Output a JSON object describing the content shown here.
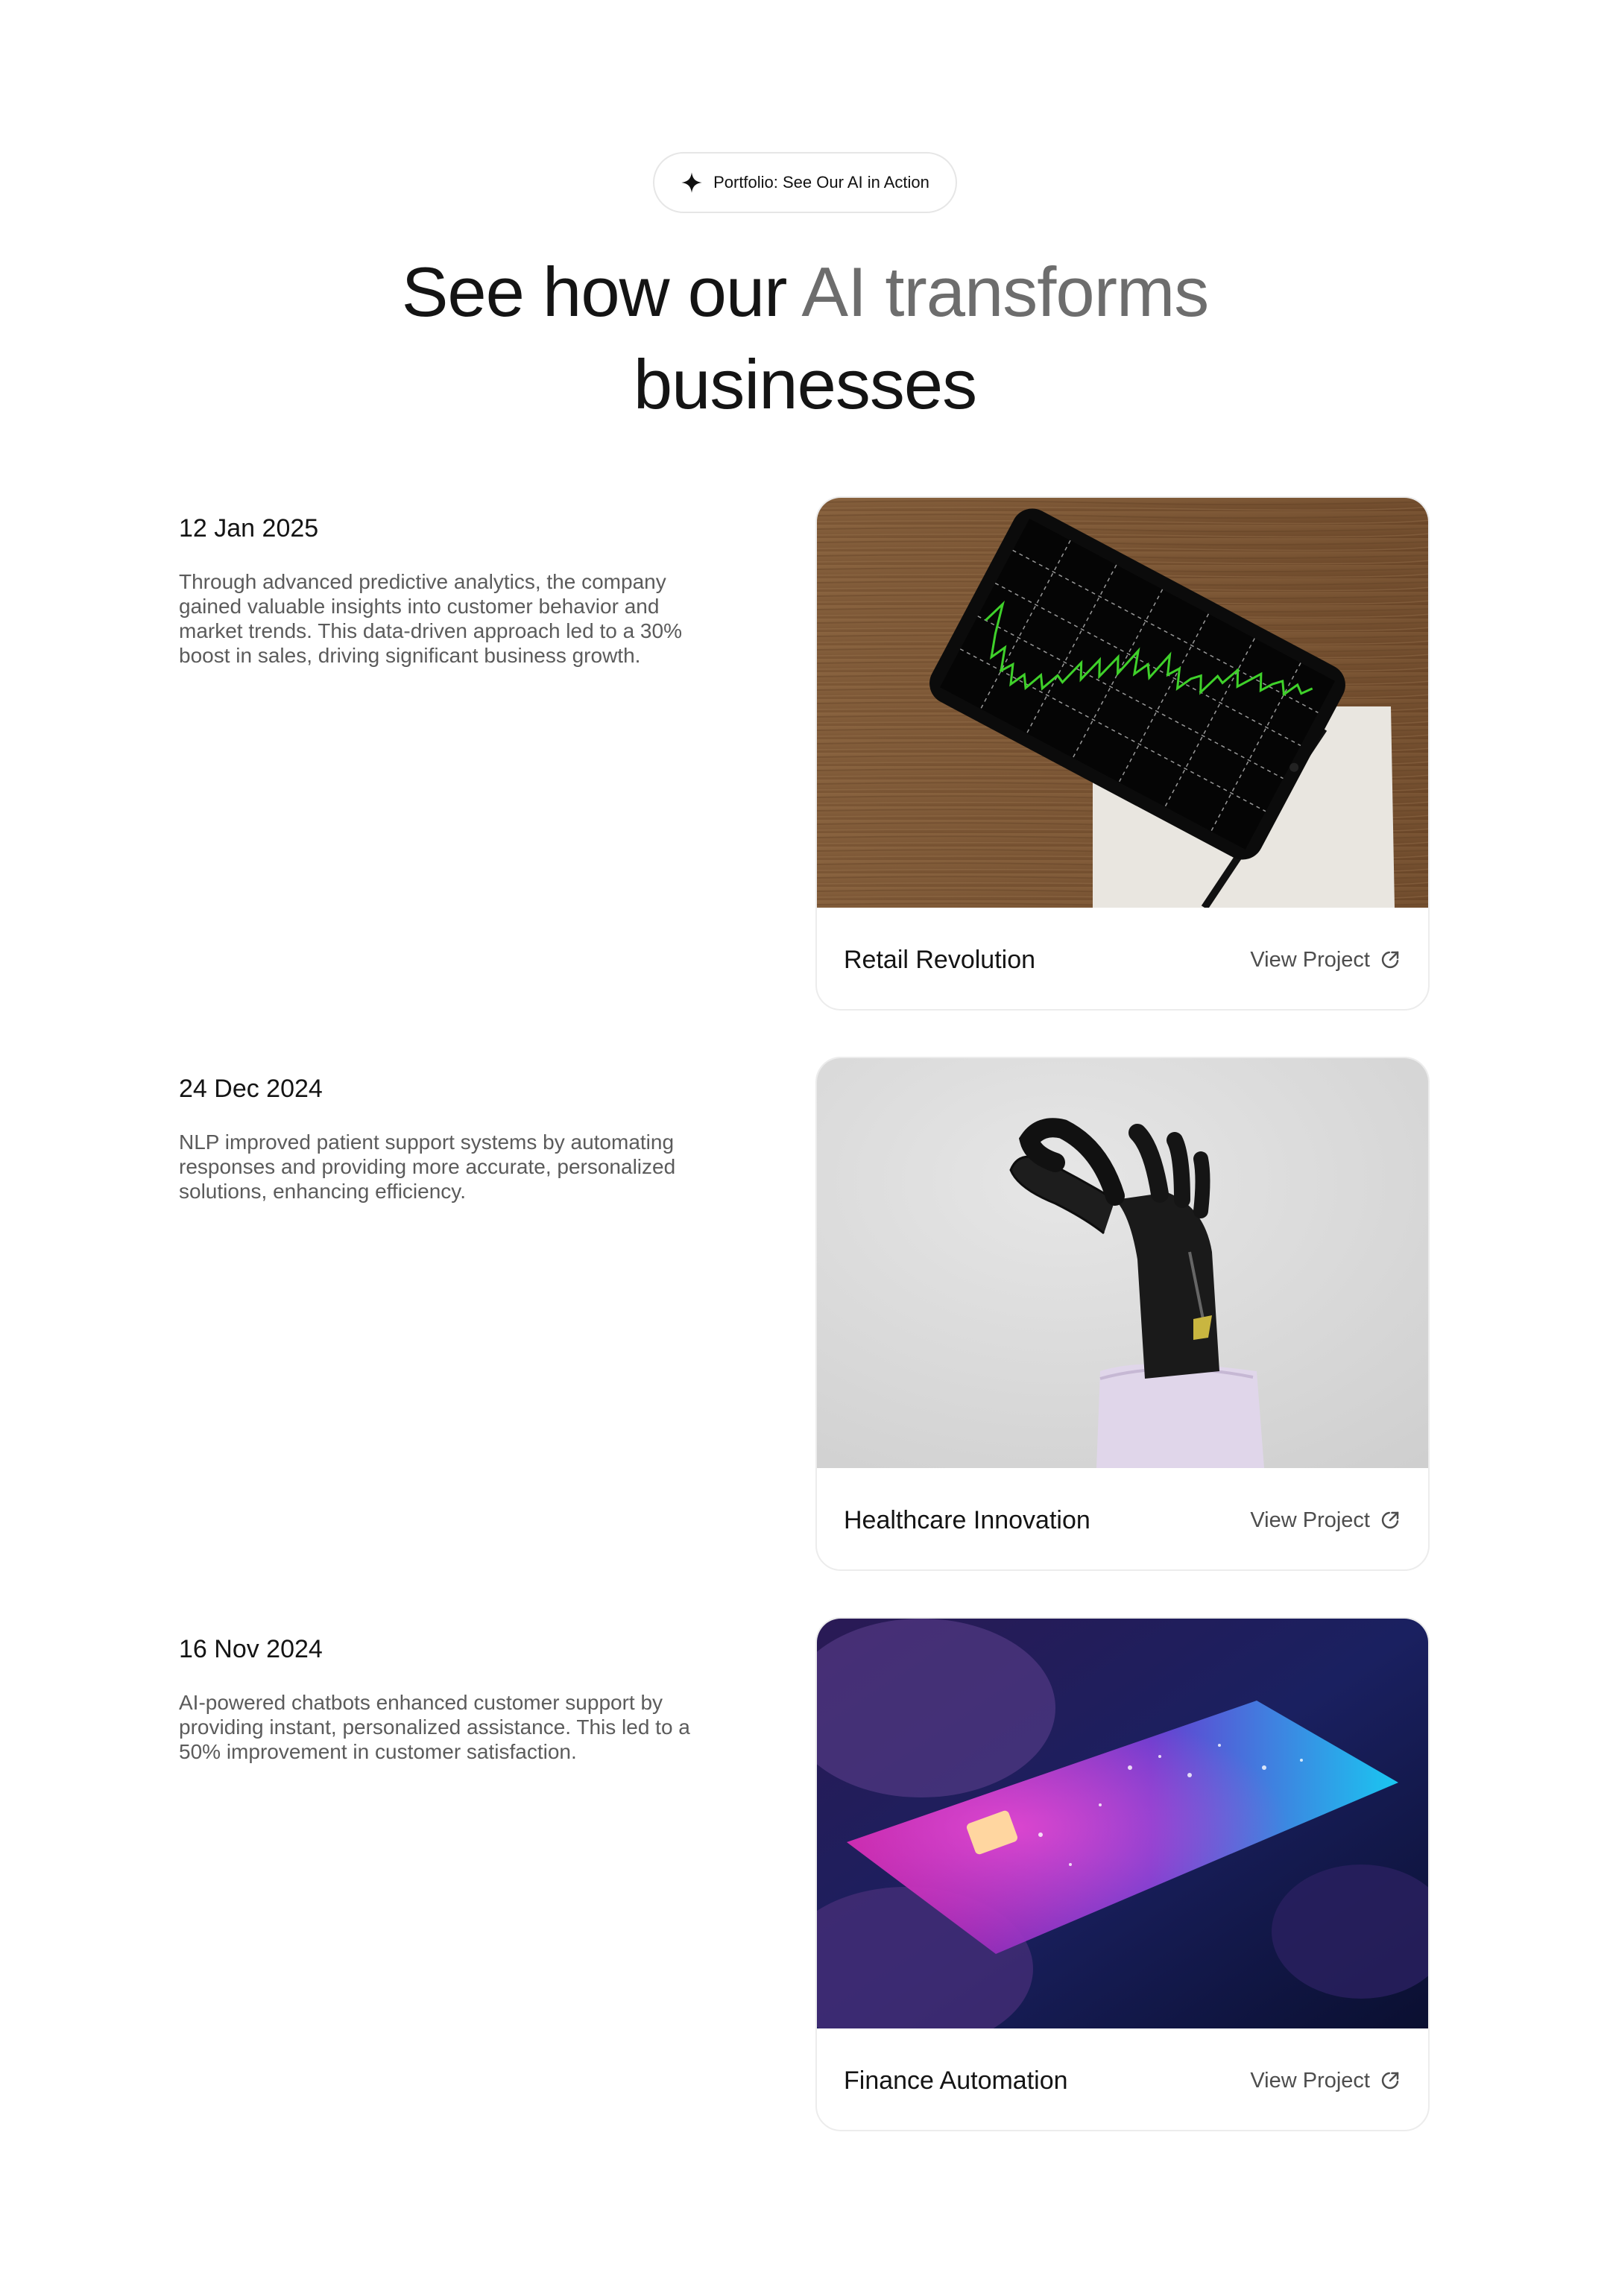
{
  "badge": {
    "icon": "sparkle-icon",
    "label": "Portfolio: See Our AI in Action"
  },
  "headline": {
    "part1": "See how our ",
    "part2_muted": "AI transforms",
    "part3": "businesses"
  },
  "projects": [
    {
      "date": "12 Jan 2025",
      "description": "Through advanced predictive analytics, the company gained valuable insights into customer behavior and market trends. This data-driven approach led to a 30% boost in sales, driving significant business growth.",
      "title": "Retail Revolution",
      "link_label": "View Project",
      "image": "tablet-stock-chart-image"
    },
    {
      "date": "24 Dec 2024",
      "description": "NLP improved patient support systems by automating responses and providing more accurate, personalized solutions, enhancing efficiency.",
      "title": "Healthcare Innovation",
      "link_label": "View Project",
      "image": "robotic-hand-image"
    },
    {
      "date": "16 Nov 2024",
      "description": "AI-powered chatbots enhanced customer support by providing instant, personalized assistance. This led to a 50% improvement in customer satisfaction.",
      "title": "Finance Automation",
      "link_label": "View Project",
      "image": "glowing-credit-card-image"
    }
  ],
  "colors": {
    "muted_heading": "#6d6d6d",
    "text": "#141414",
    "body_text": "#5b5b5b",
    "border": "#ececec"
  }
}
